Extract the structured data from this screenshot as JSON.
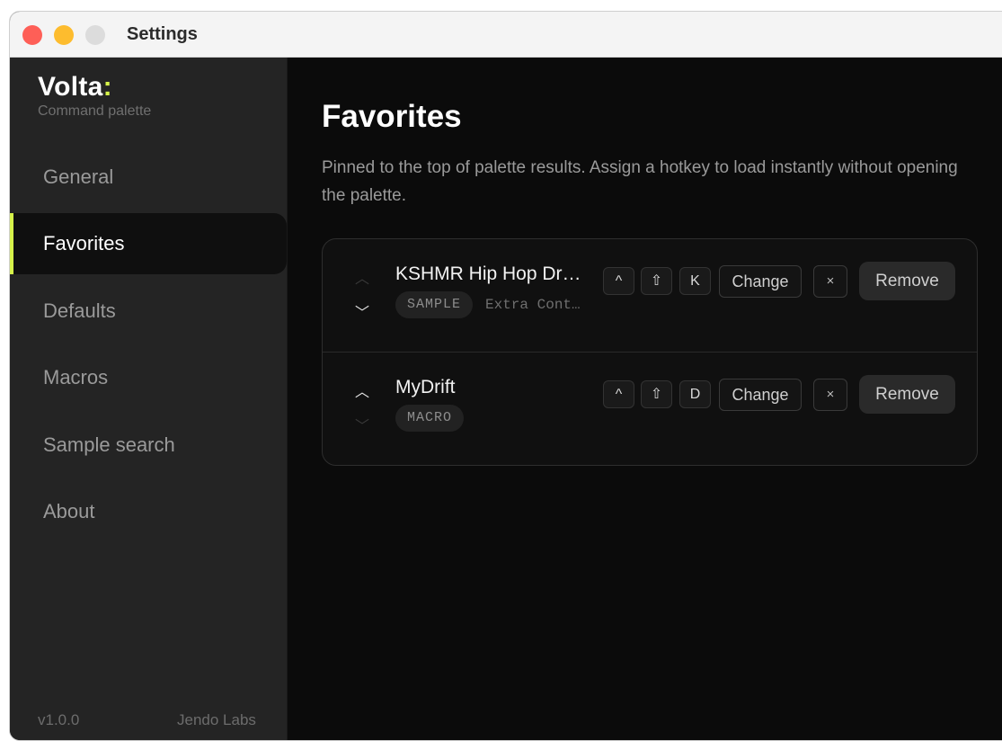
{
  "window": {
    "title": "Settings"
  },
  "sidebar": {
    "brand_name": "Volta",
    "brand_colon": ":",
    "brand_subtitle": "Command palette",
    "items": [
      {
        "label": "General",
        "active": false
      },
      {
        "label": "Favorites",
        "active": true
      },
      {
        "label": "Defaults",
        "active": false
      },
      {
        "label": "Macros",
        "active": false
      },
      {
        "label": "Sample search",
        "active": false
      },
      {
        "label": "About",
        "active": false
      }
    ],
    "version": "v1.0.0",
    "company": "Jendo Labs"
  },
  "main": {
    "title": "Favorites",
    "description": "Pinned to the top of palette results. Assign a hotkey to load instantly without opening the palette.",
    "favorites": [
      {
        "name": "KSHMR Hip Hop Dr…",
        "type": "SAMPLE",
        "meta": "Extra Cont…",
        "keys": [
          "^",
          "⇧",
          "K"
        ],
        "change_label": "Change",
        "clear_label": "×",
        "remove_label": "Remove"
      },
      {
        "name": "MyDrift",
        "type": "MACRO",
        "meta": "",
        "keys": [
          "^",
          "⇧",
          "D"
        ],
        "change_label": "Change",
        "clear_label": "×",
        "remove_label": "Remove"
      }
    ]
  },
  "colors": {
    "accent": "#d6f24a",
    "sidebar_bg": "#242424",
    "main_bg": "#0b0b0b"
  }
}
